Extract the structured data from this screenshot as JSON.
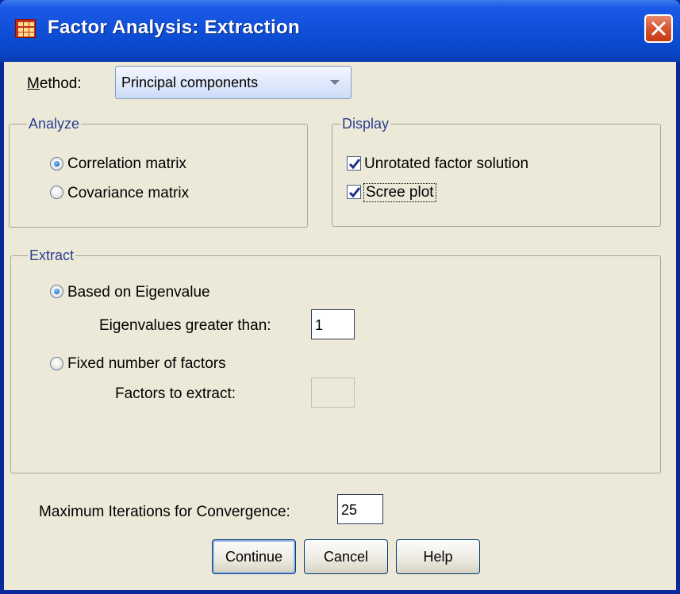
{
  "window": {
    "title": "Factor Analysis: Extraction"
  },
  "method": {
    "label": "Method:",
    "value": "Principal components"
  },
  "analyze": {
    "legend": "Analyze",
    "options": [
      {
        "label": "Correlation matrix",
        "selected": true
      },
      {
        "label": "Covariance matrix",
        "selected": false
      }
    ]
  },
  "display": {
    "legend": "Display",
    "options": [
      {
        "label": "Unrotated factor solution",
        "checked": true
      },
      {
        "label": "Scree plot",
        "checked": true
      }
    ]
  },
  "extract": {
    "legend": "Extract",
    "eigen_option": "Based on Eigenvalue",
    "eigen_label": "Eigenvalues greater than:",
    "eigen_value": "1",
    "fixed_option": "Fixed number of factors",
    "factors_label": "Factors to extract:",
    "factors_value": ""
  },
  "iterations": {
    "label": "Maximum Iterations for Convergence:",
    "value": "25"
  },
  "buttons": {
    "continue": "Continue",
    "cancel": "Cancel",
    "help": "Help"
  },
  "icons": {
    "app": "spss-table-icon",
    "close": "close-icon",
    "dropdown": "chevron-down-icon",
    "check": "check-icon"
  },
  "colors": {
    "titlebar": "#0f4fd8",
    "dialog_bg": "#ece9d8",
    "close_button": "#d65530",
    "legend_text": "#2b3f8f"
  }
}
